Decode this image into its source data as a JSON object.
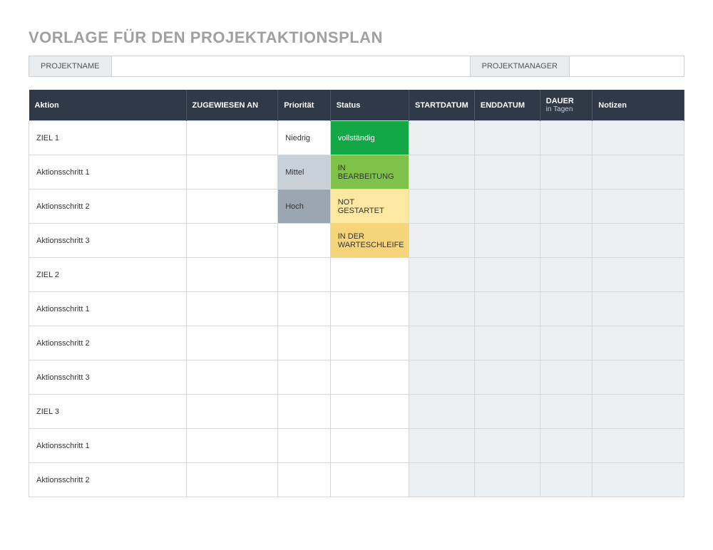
{
  "title": "VORLAGE FÜR DEN PROJEKTAKTIONSPLAN",
  "info": {
    "project_name_label": "PROJEKTNAME",
    "project_name_value": "",
    "project_manager_label": "PROJEKTMANAGER",
    "project_manager_value": ""
  },
  "headers": {
    "aktion": "Aktion",
    "zugewiesen": "ZUGEWIESEN AN",
    "prioritaet": "Priorität",
    "status": "Status",
    "startdatum": "STARTDATUM",
    "enddatum": "ENDDATUM",
    "dauer": "DAUER",
    "dauer_sub": "in Tagen",
    "notizen": "Notizen"
  },
  "priority_levels": {
    "niedrig": "Niedrig",
    "mittel": "Mittel",
    "hoch": "Hoch"
  },
  "status_levels": {
    "vollstaendig": "vollständig",
    "in_bearbeitung": "IN BEARBEITUNG",
    "not_gestartet": "NOT GESTARTET",
    "in_warteschleife": "IN DER WARTESCHLEIFE"
  },
  "rows": [
    {
      "aktion": "ZIEL 1",
      "zugewiesen": "",
      "prioritaet": "Niedrig",
      "prio_class": "pri-niedrig",
      "status": "vollständig",
      "status_class": "st-voll",
      "start": "",
      "end": "",
      "dauer": "",
      "notizen": ""
    },
    {
      "aktion": "Aktionsschritt 1",
      "zugewiesen": "",
      "prioritaet": "Mittel",
      "prio_class": "pri-mittel",
      "status": "IN BEARBEITUNG",
      "status_class": "st-bearb",
      "start": "",
      "end": "",
      "dauer": "",
      "notizen": ""
    },
    {
      "aktion": "Aktionsschritt 2",
      "zugewiesen": "",
      "prioritaet": "Hoch",
      "prio_class": "pri-hoch",
      "status": "NOT GESTARTET",
      "status_class": "st-not",
      "start": "",
      "end": "",
      "dauer": "",
      "notizen": ""
    },
    {
      "aktion": "Aktionsschritt 3",
      "zugewiesen": "",
      "prioritaet": "",
      "prio_class": "",
      "status": "IN DER WARTESCHLEIFE",
      "status_class": "st-wart",
      "start": "",
      "end": "",
      "dauer": "",
      "notizen": ""
    },
    {
      "aktion": "ZIEL 2",
      "zugewiesen": "",
      "prioritaet": "",
      "prio_class": "",
      "status": "",
      "status_class": "",
      "start": "",
      "end": "",
      "dauer": "",
      "notizen": ""
    },
    {
      "aktion": "Aktionsschritt 1",
      "zugewiesen": "",
      "prioritaet": "",
      "prio_class": "",
      "status": "",
      "status_class": "",
      "start": "",
      "end": "",
      "dauer": "",
      "notizen": ""
    },
    {
      "aktion": "Aktionsschritt 2",
      "zugewiesen": "",
      "prioritaet": "",
      "prio_class": "",
      "status": "",
      "status_class": "",
      "start": "",
      "end": "",
      "dauer": "",
      "notizen": ""
    },
    {
      "aktion": "Aktionsschritt 3",
      "zugewiesen": "",
      "prioritaet": "",
      "prio_class": "",
      "status": "",
      "status_class": "",
      "start": "",
      "end": "",
      "dauer": "",
      "notizen": ""
    },
    {
      "aktion": "ZIEL 3",
      "zugewiesen": "",
      "prioritaet": "",
      "prio_class": "",
      "status": "",
      "status_class": "",
      "start": "",
      "end": "",
      "dauer": "",
      "notizen": ""
    },
    {
      "aktion": "Aktionsschritt 1",
      "zugewiesen": "",
      "prioritaet": "",
      "prio_class": "",
      "status": "",
      "status_class": "",
      "start": "",
      "end": "",
      "dauer": "",
      "notizen": ""
    },
    {
      "aktion": "Aktionsschritt 2",
      "zugewiesen": "",
      "prioritaet": "",
      "prio_class": "",
      "status": "",
      "status_class": "",
      "start": "",
      "end": "",
      "dauer": "",
      "notizen": ""
    }
  ]
}
